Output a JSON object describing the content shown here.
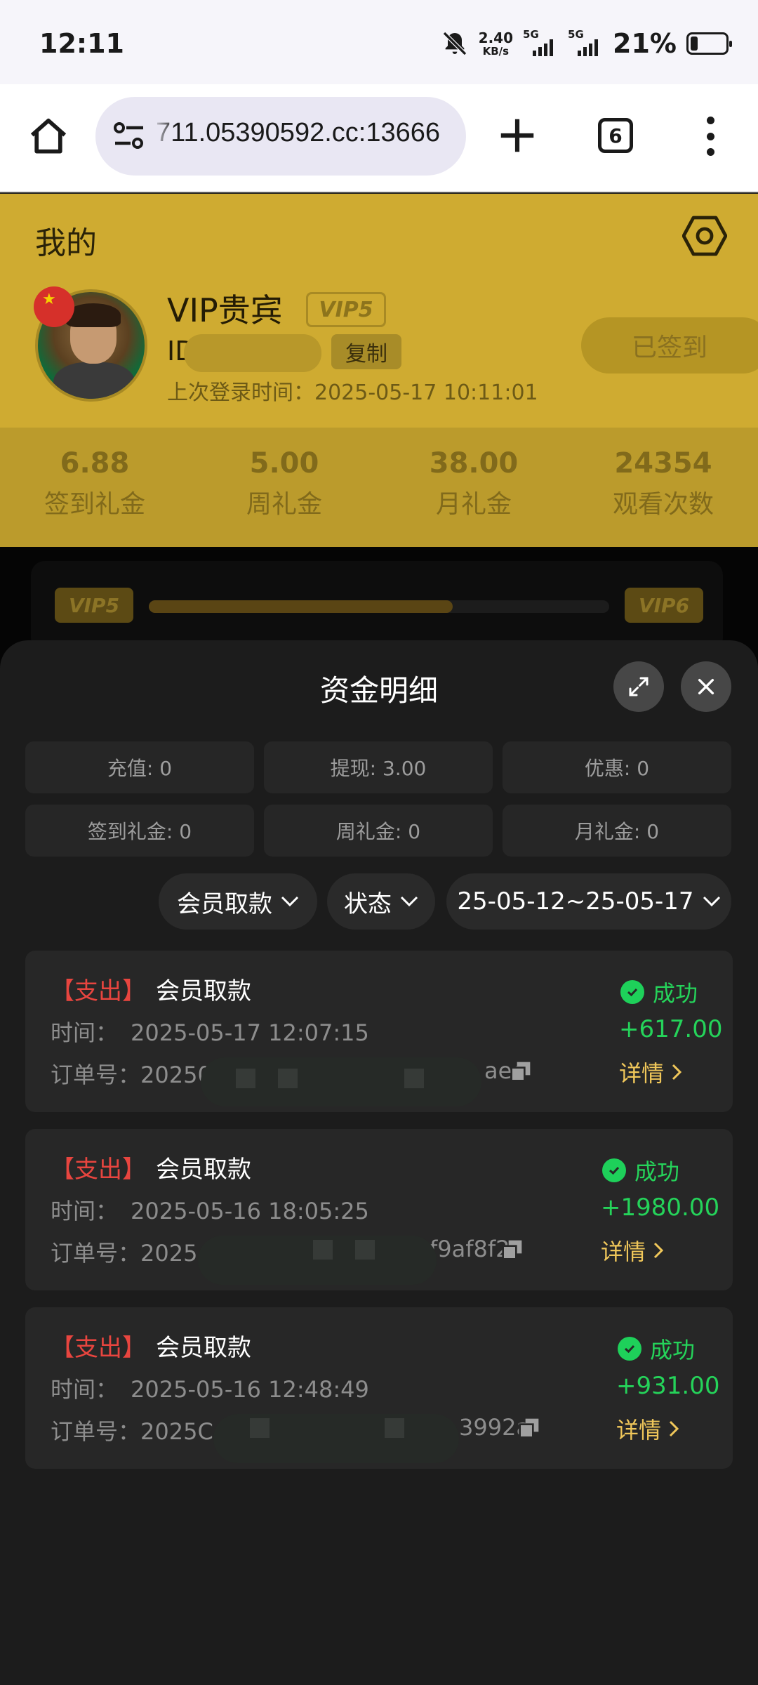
{
  "status_bar": {
    "time": "12:11",
    "net_speed": "2.40",
    "net_unit": "KB/s",
    "sim1": "5G",
    "sim2": "5G",
    "battery": "21%"
  },
  "browser": {
    "url": "711.05390592.cc:13666",
    "tab_count": "6"
  },
  "profile": {
    "title": "我的",
    "name": "VIP贵宾",
    "vip_badge": "VIP5",
    "id_label": "ID",
    "copy_label": "复制",
    "last_login": "上次登录时间：2025-05-17 10:11:01",
    "signed_label": "已签到"
  },
  "gifts": [
    {
      "value": "6.88",
      "label": "签到礼金"
    },
    {
      "value": "5.00",
      "label": "周礼金"
    },
    {
      "value": "38.00",
      "label": "月礼金"
    },
    {
      "value": "24354",
      "label": "观看次数"
    }
  ],
  "level": {
    "current": "VIP5",
    "next": "VIP6",
    "progress": 0.66
  },
  "sheet": {
    "title": "资金明细",
    "stats": [
      "充值: 0",
      "提现: 3.00",
      "优惠: 0",
      "签到礼金: 0",
      "周礼金: 0",
      "月礼金: 0"
    ],
    "filters": {
      "type": "会员取款",
      "status": "状态",
      "date_range": "25-05-12~25-05-17"
    },
    "transactions": [
      {
        "tag": "【支出】",
        "name": "会员取款",
        "time_label": "时间：",
        "time": "2025-05-17 12:07:15",
        "order_label": "订单号：",
        "order": "2025051712052853",
        "order_tail": "aec",
        "status": "成功",
        "amount": "+617.00",
        "detail": "详情"
      },
      {
        "tag": "【支出】",
        "name": "会员取款",
        "time_label": "时间：",
        "time": "2025-05-16 18:05:25",
        "order_label": "订单号：",
        "order": "2025",
        "order_tail": "f9af8f2",
        "status": "成功",
        "amount": "+1980.00",
        "detail": "详情"
      },
      {
        "tag": "【支出】",
        "name": "会员取款",
        "time_label": "时间：",
        "time": "2025-05-16 12:48:49",
        "order_label": "订单号：",
        "order": "2025C",
        "order_tail": "3992a",
        "status": "成功",
        "amount": "+931.00",
        "detail": "详情"
      }
    ]
  },
  "colors": {
    "accent_gold": "#cfab31",
    "success": "#25d35a",
    "expense_red": "#e8453f",
    "detail_gold": "#f0c75a"
  },
  "icons": [
    "bell-off-icon",
    "home-icon",
    "tune-icon",
    "plus-icon",
    "tabs-icon",
    "more-vert-icon",
    "settings-hex-icon",
    "expand-icon",
    "close-icon",
    "chevron-down-icon",
    "check-circle-icon",
    "copy-icon",
    "chevron-right-icon"
  ]
}
